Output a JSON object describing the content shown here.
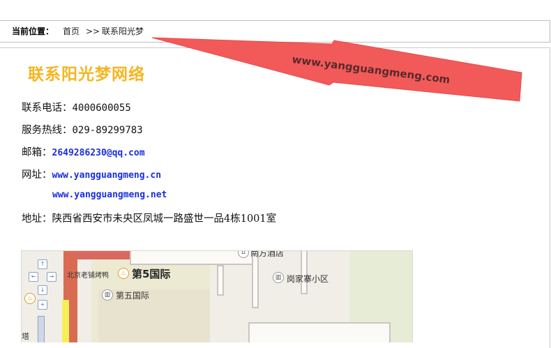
{
  "breadcrumb": {
    "label": "当前位置：",
    "home": "首页",
    "separator": ">>",
    "current": "联系阳光梦"
  },
  "banner": {
    "text": "www.yangguangmeng.com",
    "color": "#f25a5a"
  },
  "contact": {
    "title": "联系阳光梦网络",
    "title_color": "#f6b51e",
    "phone_label": "联系电话：",
    "phone": "4000600055",
    "hotline_label": "服务热线：",
    "hotline": "029-89299783",
    "email_label": "邮箱：",
    "email": "2649286230@qq.com",
    "website_label": "网址：",
    "website1": "www.yangguangmeng.cn",
    "website2": "www.yangguangmeng.net",
    "address_label": "地址：",
    "address": "陕西省西安市未央区凤城一路盛世一品4栋1001室",
    "link_color": "#1a2ee0"
  },
  "map": {
    "label_hotel": "南方酒店",
    "label_restaurant": "北京老铺烤鸭",
    "label_big": "第5国际",
    "label_small": "第五国际",
    "label_residential": "岗家寨小区",
    "label_edge": "塔"
  }
}
